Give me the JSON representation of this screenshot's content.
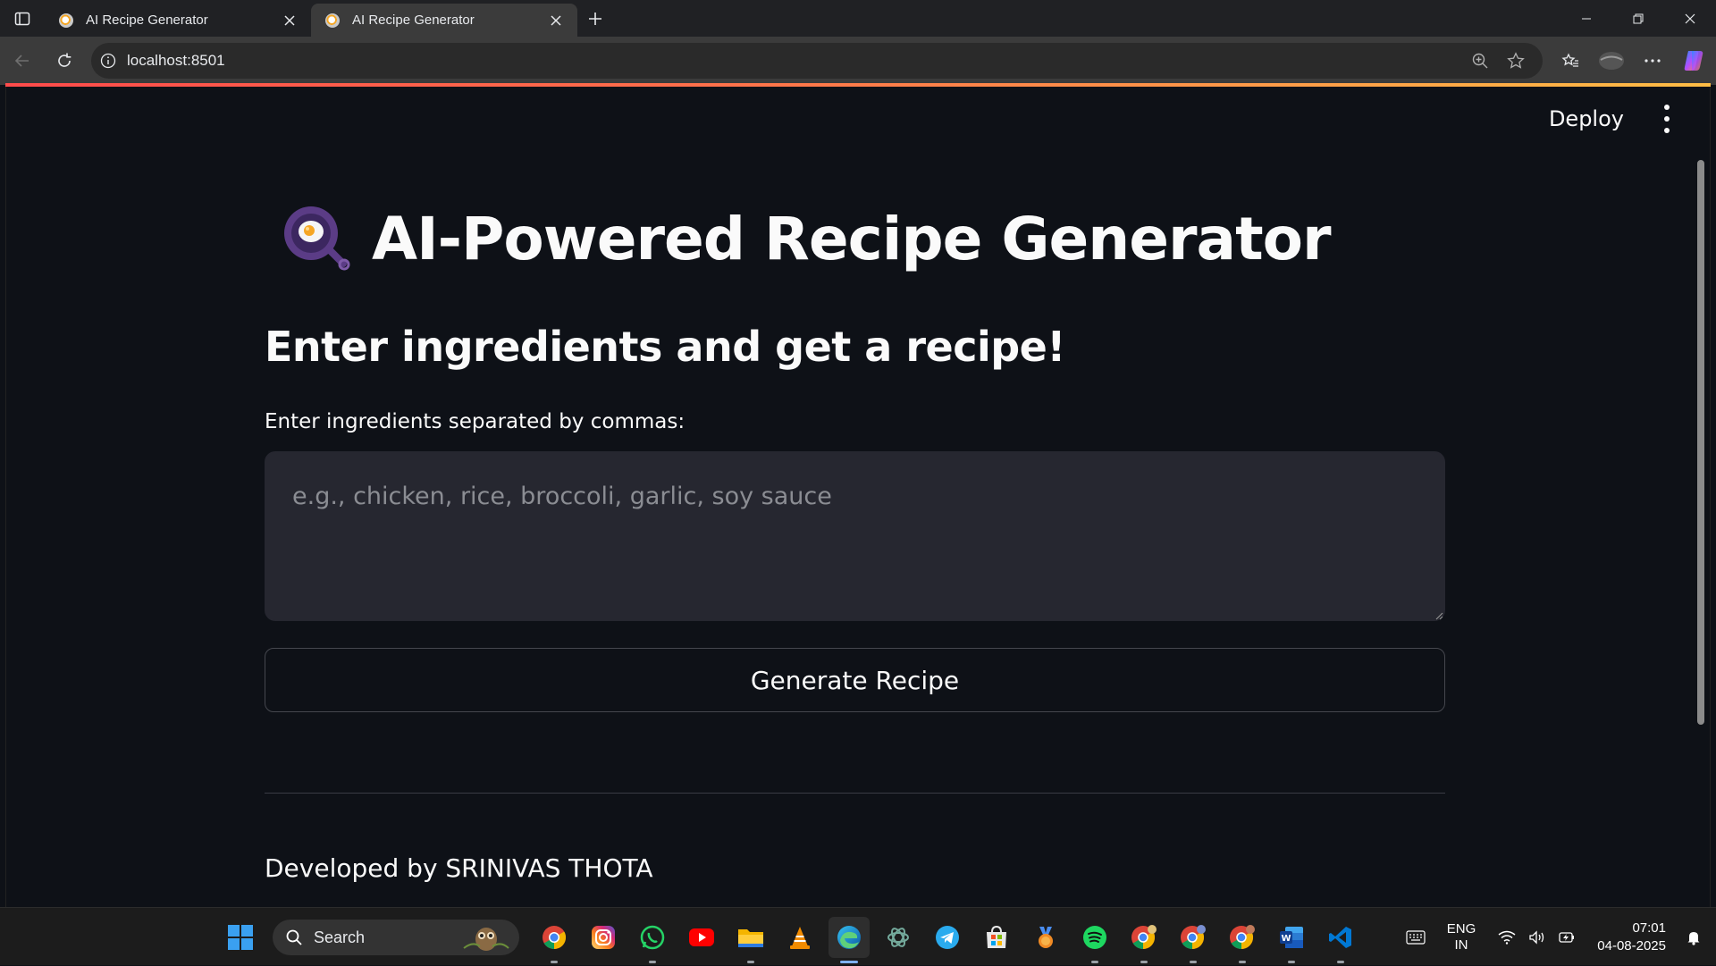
{
  "browser": {
    "tabs": [
      {
        "title": "AI Recipe Generator",
        "active": false
      },
      {
        "title": "AI Recipe Generator",
        "active": true
      }
    ],
    "url": "localhost:8501"
  },
  "app": {
    "deploy_label": "Deploy",
    "title": "AI-Powered Recipe Generator",
    "subtitle": "Enter ingredients and get a recipe!",
    "input_label": "Enter ingredients separated by commas:",
    "input_placeholder": "e.g., chicken, rice, broccoli, garlic, soy sauce",
    "input_value": "",
    "button_label": "Generate Recipe",
    "footer": "Developed by SRINIVAS THOTA",
    "accent_gradient": [
      "#ff4b4b",
      "#ffbd45"
    ],
    "background": "#0e1117"
  },
  "taskbar": {
    "search_label": "Search",
    "apps": [
      "chrome-icon",
      "instagram-icon",
      "whatsapp-icon",
      "youtube-icon",
      "file-explorer-icon",
      "vlc-icon",
      "edge-icon",
      "chatgpt-icon",
      "telegram-icon",
      "microsoft-store-icon",
      "badge-app-icon",
      "spotify-icon",
      "chrome-profile-icon",
      "chrome-profile-icon",
      "chrome-profile-icon",
      "word-icon",
      "vscode-icon"
    ],
    "language": {
      "line1": "ENG",
      "line2": "IN"
    },
    "time": "07:01",
    "date": "04-08-2025"
  }
}
